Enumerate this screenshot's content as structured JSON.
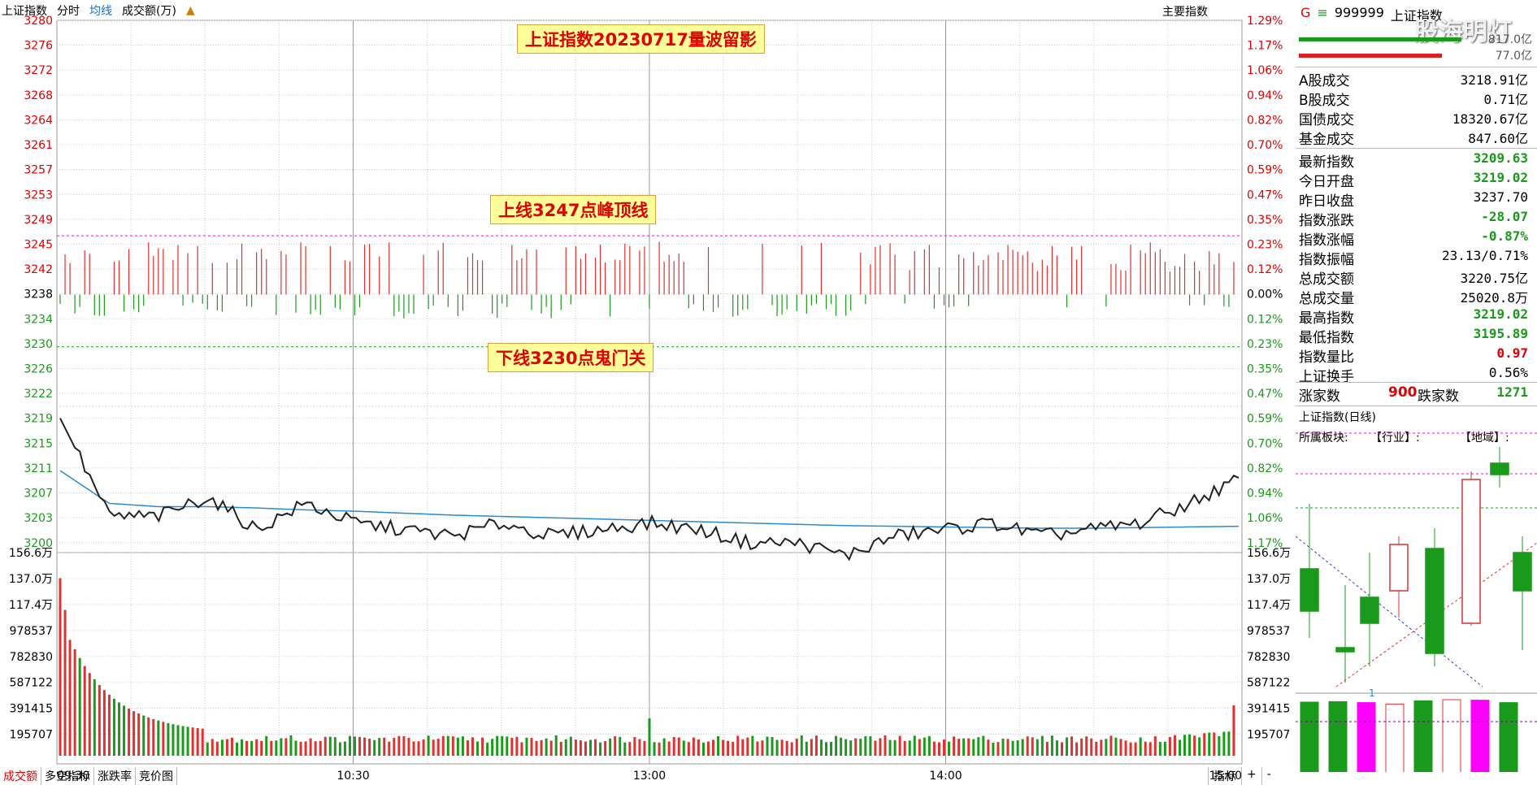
{
  "toolbar": {
    "title": "上证指数",
    "tab_fenshi": "分时",
    "tab_junxian": "均线",
    "tab_volume": "成交额(万)",
    "main_index_label": "主要指数"
  },
  "annotations": {
    "title": "上证指数20230717量波留影",
    "upper_line": "上线3247点峰顶线",
    "lower_line": "下线3230点鬼门关"
  },
  "axes": {
    "price_labels": [
      "3280",
      "3276",
      "3272",
      "3268",
      "3264",
      "3261",
      "3257",
      "3253",
      "3249",
      "3245",
      "3242",
      "3238",
      "3234",
      "3230",
      "3226",
      "3222",
      "3219",
      "3215",
      "3211",
      "3207",
      "3203",
      "3200"
    ],
    "pct_labels": [
      "1.29%",
      "1.17%",
      "1.06%",
      "0.94%",
      "0.82%",
      "0.70%",
      "0.59%",
      "0.47%",
      "0.35%",
      "0.23%",
      "0.12%",
      "0.00%",
      "0.12%",
      "0.23%",
      "0.35%",
      "0.47%",
      "0.59%",
      "0.70%",
      "0.82%",
      "0.94%",
      "1.06%",
      "1.17%"
    ],
    "volume_labels": [
      "156.6万",
      "137.0万",
      "117.4万",
      "978537",
      "782830",
      "587122",
      "391415",
      "195707"
    ],
    "time_labels": [
      "09:30",
      "10:30",
      "13:00",
      "14:00",
      "15:00"
    ]
  },
  "chart_data": [
    {
      "type": "bar",
      "name": "breadth bars",
      "zero_level": 3238,
      "upper_line": 3247,
      "lower_line": 3230,
      "ylim": [
        3222,
        3280
      ]
    },
    {
      "type": "line",
      "name": "price",
      "ylim": [
        3200,
        3222
      ],
      "x": [
        "09:30",
        "09:40",
        "09:50",
        "10:00",
        "10:10",
        "10:20",
        "10:30",
        "10:40",
        "10:50",
        "11:00",
        "11:10",
        "11:20",
        "11:30",
        "13:10",
        "13:20",
        "13:30",
        "13:40",
        "13:50",
        "14:00",
        "14:10",
        "14:20",
        "14:30",
        "14:40",
        "14:50",
        "15:00"
      ],
      "values": [
        3219,
        3204,
        3204,
        3207,
        3202,
        3206,
        3203,
        3202,
        3201,
        3203,
        3201,
        3202,
        3203,
        3202,
        3200,
        3200,
        3198,
        3201,
        3202,
        3203,
        3201,
        3202,
        3203,
        3206,
        3209.63
      ]
    },
    {
      "type": "line",
      "name": "average",
      "values": [
        3211,
        3206,
        3205.5,
        3205.5,
        3205.3,
        3205,
        3204.8,
        3204.5,
        3204.2,
        3204,
        3203.8,
        3203.6,
        3203.4,
        3203.2,
        3203,
        3202.8,
        3202.6,
        3202.5,
        3202.4,
        3202.3,
        3202.2,
        3202.2,
        3202.3,
        3202.4,
        3202.5
      ]
    },
    {
      "type": "bar",
      "name": "volume",
      "ylim": [
        0,
        1566000
      ]
    }
  ],
  "panel": {
    "code_prefix": "G",
    "code": "999999",
    "name": "上证指数",
    "top_value_1": "817.0亿",
    "top_value_2": "77.0亿",
    "watermark": "股海明灯",
    "stats1": [
      {
        "label": "A股成交",
        "value": "3218.91亿"
      },
      {
        "label": "B股成交",
        "value": "0.71亿"
      },
      {
        "label": "国债成交",
        "value": "18320.67亿"
      },
      {
        "label": "基金成交",
        "value": "847.60亿"
      }
    ],
    "stats2": [
      {
        "label": "最新指数",
        "value": "3209.63",
        "color": "green"
      },
      {
        "label": "今日开盘",
        "value": "3219.02",
        "color": "green"
      },
      {
        "label": "昨日收盘",
        "value": "3237.70",
        "color": "black"
      },
      {
        "label": "指数涨跌",
        "value": "-28.07",
        "color": "green"
      },
      {
        "label": "指数涨幅",
        "value": "-0.87%",
        "color": "green"
      },
      {
        "label": "指数振幅",
        "value": "23.13/0.71%",
        "color": "black"
      },
      {
        "label": "总成交额",
        "value": "3220.75亿",
        "color": "black"
      },
      {
        "label": "总成交量",
        "value": "25020.8万",
        "color": "black"
      },
      {
        "label": "最高指数",
        "value": "3219.02",
        "color": "green"
      },
      {
        "label": "最低指数",
        "value": "3195.89",
        "color": "green"
      },
      {
        "label": "指数量比",
        "value": "0.97",
        "color": "red"
      },
      {
        "label": "上证换手",
        "value": "0.56%",
        "color": "black"
      }
    ],
    "breadth": {
      "up_label": "涨家数",
      "up_value": "900",
      "down_label": "跌家数",
      "down_value": "1271"
    },
    "daily_title": "上证指数(日线)",
    "sector_label": "所属板块:",
    "industry_label": "【行业】:",
    "region_label": "【地域】:",
    "mini_marker": "1"
  },
  "bottom_tabs": [
    "成交额",
    "多空指标",
    "涨跌率",
    "竞价图"
  ],
  "bottom_right": [
    "指标",
    "+",
    "-"
  ]
}
